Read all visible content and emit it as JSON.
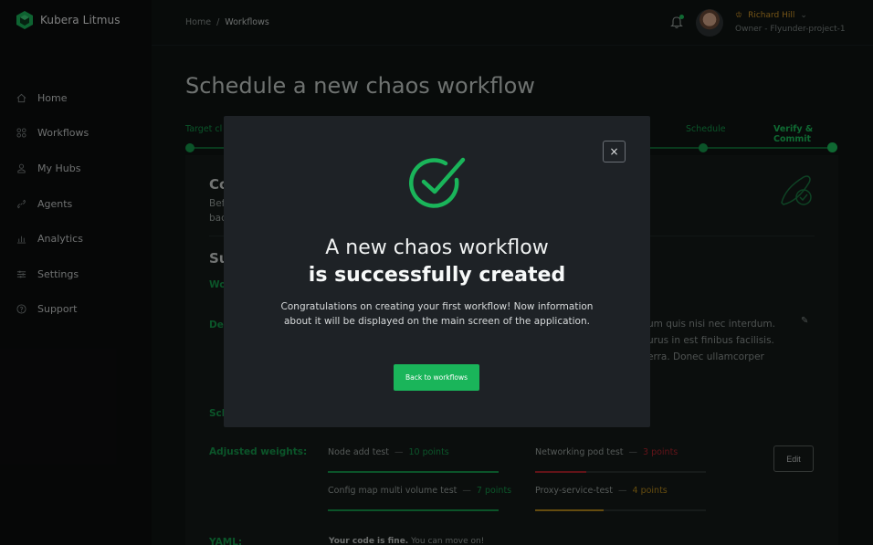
{
  "app": {
    "name": "Kubera Litmus"
  },
  "sidebar": {
    "items": [
      {
        "label": "Home",
        "icon": "home-icon"
      },
      {
        "label": "Workflows",
        "icon": "grid-icon"
      },
      {
        "label": "My Hubs",
        "icon": "user-icon"
      },
      {
        "label": "Agents",
        "icon": "link-icon"
      },
      {
        "label": "Analytics",
        "icon": "bar-chart-icon"
      },
      {
        "label": "Settings",
        "icon": "sliders-icon"
      },
      {
        "label": "Support",
        "icon": "help-icon"
      }
    ]
  },
  "breadcrumb": {
    "home": "Home",
    "separator": "/",
    "current": "Workflows"
  },
  "user": {
    "name": "Richard Hill",
    "role": "Owner - Flyunder-project-1"
  },
  "page": {
    "title": "Schedule a new chaos workflow"
  },
  "steps": {
    "first": "Target cl",
    "schedule": "Schedule",
    "verify": "Verify & Commit"
  },
  "card": {
    "title": "Co",
    "subtitle_line1": "Bef",
    "subtitle_line2": "bac",
    "summary_title": "Su",
    "workflow_label": "Wo",
    "description_label": "Des",
    "schedule_label": "Sch",
    "description_lines": [
      "um quis nisi nec interdum.",
      "urus in est finibus facilisis.",
      "erra. Donec ullamcorper"
    ],
    "adjusted_weights_label": "Adjusted weights:",
    "weights": [
      {
        "name": "Node add test",
        "points": "10 points",
        "color": "#149a4b",
        "fill": 1.0
      },
      {
        "name": "Networking pod test",
        "points": "3 points",
        "color": "#b3242d",
        "fill": 0.3
      },
      {
        "name": "Config map multi volume test",
        "points": "7 points",
        "color": "#149a4b",
        "fill": 1.0
      },
      {
        "name": "Proxy-service-test",
        "points": "4 points",
        "color": "#b88a1c",
        "fill": 0.4
      }
    ],
    "edit_label": "Edit",
    "yaml_label": "YAML:",
    "yaml_note_bold": "Your code is fine.",
    "yaml_note": " You can move on!"
  },
  "modal": {
    "title_line1": "A new chaos workflow",
    "title_line2": "is successfully created",
    "body": "Congratulations on creating your first workflow! Now information about it will be displayed on the main screen of the application.",
    "button": "Back to workflows",
    "close": "×"
  },
  "colors": {
    "accent": "#1ab55a",
    "warning": "#d49a2a",
    "danger": "#b3242d"
  }
}
